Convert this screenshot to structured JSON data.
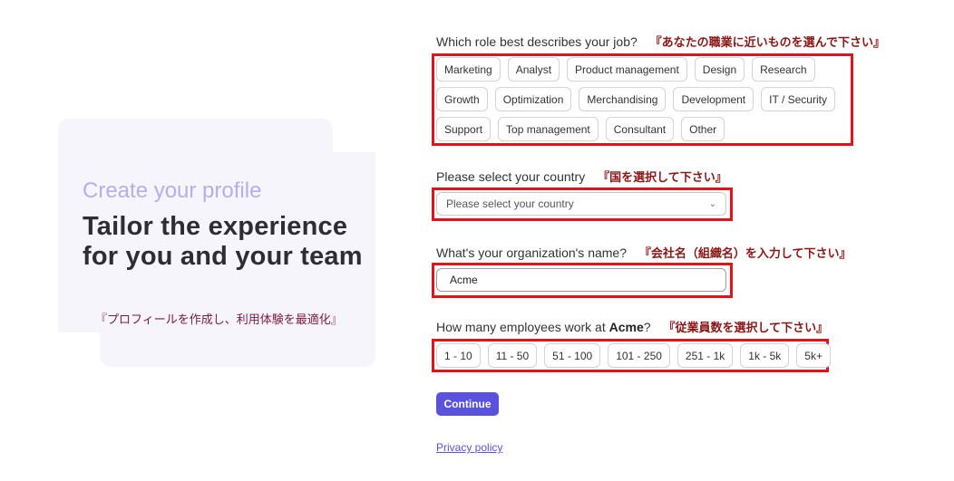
{
  "left_card": {
    "heading": "Create your profile",
    "title": "Tailor the experience for you and your team",
    "title_jp": "『プロフィールを作成し、利用体験を最適化』"
  },
  "role": {
    "question": "Which role best describes your job?",
    "question_jp": "『あなたの職業に近いものを選んで下さい』",
    "options": [
      "Marketing",
      "Analyst",
      "Product management",
      "Design",
      "Research",
      "Growth",
      "Optimization",
      "Merchandising",
      "Development",
      "IT / Security",
      "Support",
      "Top management",
      "Consultant",
      "Other"
    ]
  },
  "country": {
    "question": "Please select your country",
    "question_jp": "『国を選択して下さい』",
    "placeholder": "Please select your country"
  },
  "organization": {
    "question": "What's your organization's name?",
    "question_jp": "『会社名（組織名）を入力して下さい』",
    "value": "Acme"
  },
  "employees": {
    "question_prefix": "How many employees work at",
    "org_name": "Acme",
    "question_suffix": "?",
    "question_jp": "『従業員数を選択して下さい』",
    "options": [
      "1 - 10",
      "11 - 50",
      "51 - 100",
      "101 - 250",
      "251 - 1k",
      "1k - 5k",
      "5k+"
    ]
  },
  "continue_label": "Continue",
  "privacy_label": "Privacy policy"
}
